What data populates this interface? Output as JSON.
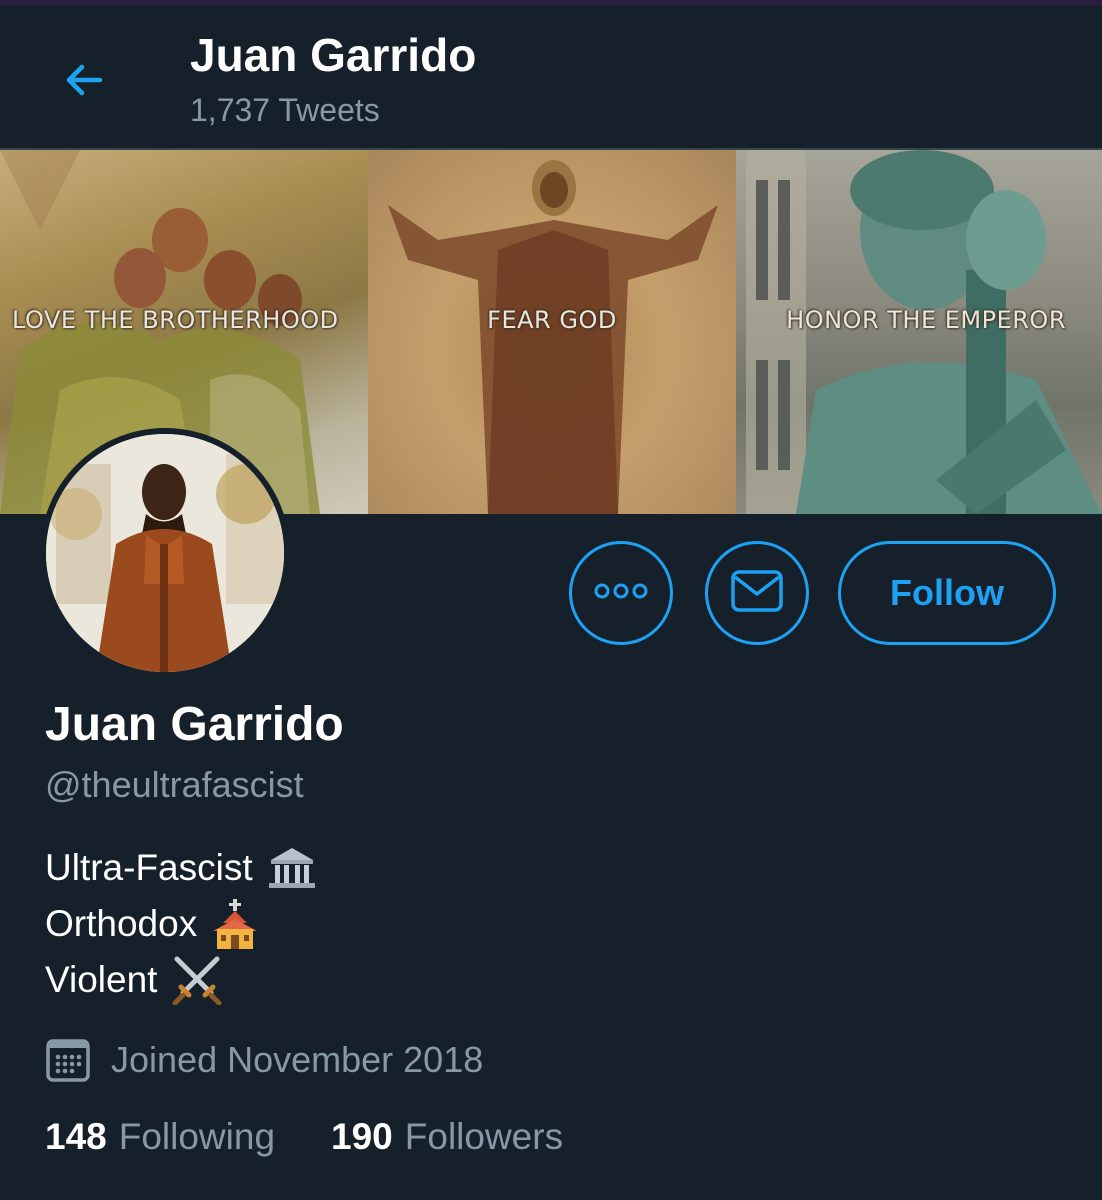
{
  "header": {
    "title": "Juan Garrido",
    "tweets_count": "1,737 Tweets",
    "back_icon": "arrow-left-icon"
  },
  "banner": {
    "panels": [
      {
        "caption": "LOVE THE BROTHERHOOD"
      },
      {
        "caption": "FEAR GOD"
      },
      {
        "caption": "HONOR THE EMPEROR"
      }
    ]
  },
  "actions": {
    "more_icon": "more-horizontal-icon",
    "message_icon": "envelope-icon",
    "follow_label": "Follow"
  },
  "profile": {
    "name": "Juan Garrido",
    "handle": "@theultrafascist",
    "bio": [
      {
        "text": "Ultra-Fascist",
        "emoji": "classical-building-icon"
      },
      {
        "text": "Orthodox",
        "emoji": "church-icon"
      },
      {
        "text": "Violent",
        "emoji": "crossed-swords-icon"
      }
    ],
    "joined": "Joined November 2018",
    "joined_icon": "calendar-icon",
    "following_count": "148",
    "following_label": "Following",
    "followers_count": "190",
    "followers_label": "Followers"
  },
  "colors": {
    "background": "#15202b",
    "accent": "#1da1f2",
    "secondary_text": "#8899a6",
    "divider": "#38444d"
  }
}
